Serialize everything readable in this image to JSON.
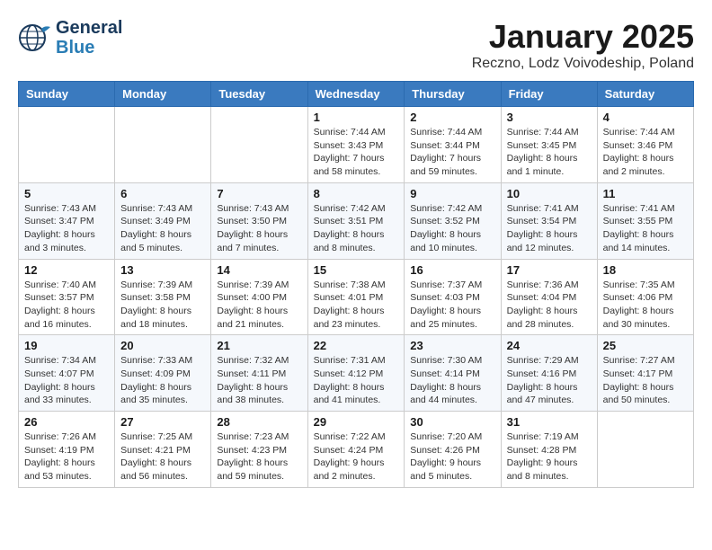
{
  "logo": {
    "line1": "General",
    "line2": "Blue"
  },
  "title": "January 2025",
  "subtitle": "Reczno, Lodz Voivodeship, Poland",
  "days_of_week": [
    "Sunday",
    "Monday",
    "Tuesday",
    "Wednesday",
    "Thursday",
    "Friday",
    "Saturday"
  ],
  "weeks": [
    [
      {
        "day": "",
        "info": ""
      },
      {
        "day": "",
        "info": ""
      },
      {
        "day": "",
        "info": ""
      },
      {
        "day": "1",
        "info": "Sunrise: 7:44 AM\nSunset: 3:43 PM\nDaylight: 7 hours\nand 58 minutes."
      },
      {
        "day": "2",
        "info": "Sunrise: 7:44 AM\nSunset: 3:44 PM\nDaylight: 7 hours\nand 59 minutes."
      },
      {
        "day": "3",
        "info": "Sunrise: 7:44 AM\nSunset: 3:45 PM\nDaylight: 8 hours\nand 1 minute."
      },
      {
        "day": "4",
        "info": "Sunrise: 7:44 AM\nSunset: 3:46 PM\nDaylight: 8 hours\nand 2 minutes."
      }
    ],
    [
      {
        "day": "5",
        "info": "Sunrise: 7:43 AM\nSunset: 3:47 PM\nDaylight: 8 hours\nand 3 minutes."
      },
      {
        "day": "6",
        "info": "Sunrise: 7:43 AM\nSunset: 3:49 PM\nDaylight: 8 hours\nand 5 minutes."
      },
      {
        "day": "7",
        "info": "Sunrise: 7:43 AM\nSunset: 3:50 PM\nDaylight: 8 hours\nand 7 minutes."
      },
      {
        "day": "8",
        "info": "Sunrise: 7:42 AM\nSunset: 3:51 PM\nDaylight: 8 hours\nand 8 minutes."
      },
      {
        "day": "9",
        "info": "Sunrise: 7:42 AM\nSunset: 3:52 PM\nDaylight: 8 hours\nand 10 minutes."
      },
      {
        "day": "10",
        "info": "Sunrise: 7:41 AM\nSunset: 3:54 PM\nDaylight: 8 hours\nand 12 minutes."
      },
      {
        "day": "11",
        "info": "Sunrise: 7:41 AM\nSunset: 3:55 PM\nDaylight: 8 hours\nand 14 minutes."
      }
    ],
    [
      {
        "day": "12",
        "info": "Sunrise: 7:40 AM\nSunset: 3:57 PM\nDaylight: 8 hours\nand 16 minutes."
      },
      {
        "day": "13",
        "info": "Sunrise: 7:39 AM\nSunset: 3:58 PM\nDaylight: 8 hours\nand 18 minutes."
      },
      {
        "day": "14",
        "info": "Sunrise: 7:39 AM\nSunset: 4:00 PM\nDaylight: 8 hours\nand 21 minutes."
      },
      {
        "day": "15",
        "info": "Sunrise: 7:38 AM\nSunset: 4:01 PM\nDaylight: 8 hours\nand 23 minutes."
      },
      {
        "day": "16",
        "info": "Sunrise: 7:37 AM\nSunset: 4:03 PM\nDaylight: 8 hours\nand 25 minutes."
      },
      {
        "day": "17",
        "info": "Sunrise: 7:36 AM\nSunset: 4:04 PM\nDaylight: 8 hours\nand 28 minutes."
      },
      {
        "day": "18",
        "info": "Sunrise: 7:35 AM\nSunset: 4:06 PM\nDaylight: 8 hours\nand 30 minutes."
      }
    ],
    [
      {
        "day": "19",
        "info": "Sunrise: 7:34 AM\nSunset: 4:07 PM\nDaylight: 8 hours\nand 33 minutes."
      },
      {
        "day": "20",
        "info": "Sunrise: 7:33 AM\nSunset: 4:09 PM\nDaylight: 8 hours\nand 35 minutes."
      },
      {
        "day": "21",
        "info": "Sunrise: 7:32 AM\nSunset: 4:11 PM\nDaylight: 8 hours\nand 38 minutes."
      },
      {
        "day": "22",
        "info": "Sunrise: 7:31 AM\nSunset: 4:12 PM\nDaylight: 8 hours\nand 41 minutes."
      },
      {
        "day": "23",
        "info": "Sunrise: 7:30 AM\nSunset: 4:14 PM\nDaylight: 8 hours\nand 44 minutes."
      },
      {
        "day": "24",
        "info": "Sunrise: 7:29 AM\nSunset: 4:16 PM\nDaylight: 8 hours\nand 47 minutes."
      },
      {
        "day": "25",
        "info": "Sunrise: 7:27 AM\nSunset: 4:17 PM\nDaylight: 8 hours\nand 50 minutes."
      }
    ],
    [
      {
        "day": "26",
        "info": "Sunrise: 7:26 AM\nSunset: 4:19 PM\nDaylight: 8 hours\nand 53 minutes."
      },
      {
        "day": "27",
        "info": "Sunrise: 7:25 AM\nSunset: 4:21 PM\nDaylight: 8 hours\nand 56 minutes."
      },
      {
        "day": "28",
        "info": "Sunrise: 7:23 AM\nSunset: 4:23 PM\nDaylight: 8 hours\nand 59 minutes."
      },
      {
        "day": "29",
        "info": "Sunrise: 7:22 AM\nSunset: 4:24 PM\nDaylight: 9 hours\nand 2 minutes."
      },
      {
        "day": "30",
        "info": "Sunrise: 7:20 AM\nSunset: 4:26 PM\nDaylight: 9 hours\nand 5 minutes."
      },
      {
        "day": "31",
        "info": "Sunrise: 7:19 AM\nSunset: 4:28 PM\nDaylight: 9 hours\nand 8 minutes."
      },
      {
        "day": "",
        "info": ""
      }
    ]
  ]
}
